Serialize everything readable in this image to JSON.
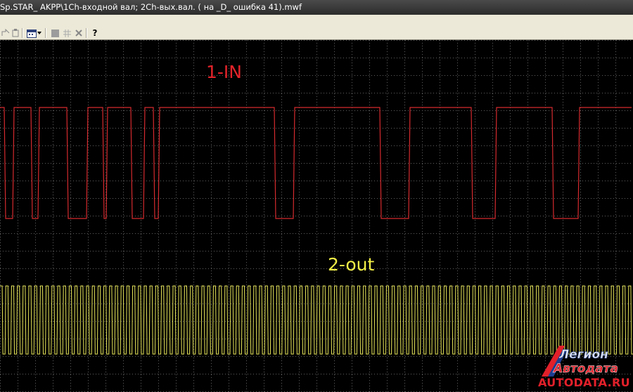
{
  "window": {
    "title": "Sp.STAR_ AKPP\\1Ch-входной вал; 2Ch-вых.вал. ( на _D_ ошибка 41).mwf"
  },
  "toolbar": {
    "icons": [
      "step-icon",
      "paste-icon",
      "calendar-icon",
      "stop-icon",
      "grid-icon",
      "close-icon",
      "help-icon"
    ]
  },
  "channels": {
    "ch1": {
      "label": "1-IN",
      "color": "#e3232a"
    },
    "ch2": {
      "label": "2-out",
      "color": "#f3f046"
    }
  },
  "watermark": {
    "line1": "Легион",
    "line2": "Автодата",
    "url": "AUTODATA.RU"
  },
  "colors": {
    "grid": "#5f5f5f",
    "background": "#000000",
    "toolbar": "#ece9d8"
  }
}
